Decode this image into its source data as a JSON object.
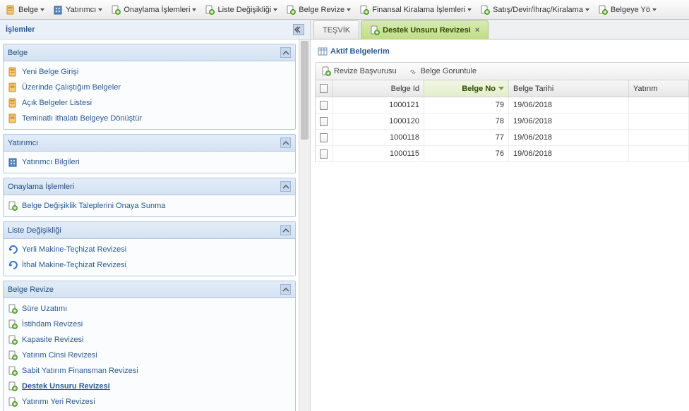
{
  "toolbar": [
    {
      "label": "Belge",
      "icon": "document"
    },
    {
      "label": "Yatırımcı",
      "icon": "building"
    },
    {
      "label": "Onaylama İşlemleri",
      "icon": "doc-green"
    },
    {
      "label": "Liste Değişikliği",
      "icon": "doc-green"
    },
    {
      "label": "Belge Revize",
      "icon": "doc-green"
    },
    {
      "label": "Finansal Kiralama İşlemleri",
      "icon": "doc-green"
    },
    {
      "label": "Satış/Devir/İhraç/Kiralama",
      "icon": "doc-green"
    },
    {
      "label": "Belgeye Yö",
      "icon": "doc-green"
    }
  ],
  "sidebar_title": "İşlemler",
  "panels": [
    {
      "title": "Belge",
      "items": [
        {
          "label": "Yeni Belge Girişi",
          "icon": "document"
        },
        {
          "label": "Üzerinde Çalıştığım Belgeler",
          "icon": "document"
        },
        {
          "label": "Açık Belgeler Listesi",
          "icon": "document"
        },
        {
          "label": "Teminatlı ithalatı Belgeye Dönüştür",
          "icon": "document"
        }
      ]
    },
    {
      "title": "Yatırımcı",
      "items": [
        {
          "label": "Yatırımcı Bilgileri",
          "icon": "building"
        }
      ]
    },
    {
      "title": "Onaylama İşlemleri",
      "items": [
        {
          "label": "Belge Değişiklik Taleplerini Onaya Sunma",
          "icon": "doc-green"
        }
      ]
    },
    {
      "title": "Liste Değişikliği",
      "items": [
        {
          "label": "Yerli Makine-Teçhizat Revizesi",
          "icon": "arrow"
        },
        {
          "label": "İthal Makine-Teçhizat Revizesi",
          "icon": "arrow"
        }
      ]
    },
    {
      "title": "Belge Revize",
      "items": [
        {
          "label": "Süre Uzatımı",
          "icon": "doc-green"
        },
        {
          "label": "İstihdam Revizesi",
          "icon": "doc-green"
        },
        {
          "label": "Kapasite Revizesi",
          "icon": "doc-green"
        },
        {
          "label": "Yatırım Cinsi Revizesi",
          "icon": "doc-green"
        },
        {
          "label": "Sabit Yatırım Finansman Revizesi",
          "icon": "doc-green"
        },
        {
          "label": "Destek Unsuru Revizesi",
          "icon": "doc-green",
          "bold": true
        },
        {
          "label": "Yatırımı Yeri Revizesi",
          "icon": "doc-green"
        }
      ]
    }
  ],
  "tabs": [
    {
      "label": "TEŞVİK",
      "active": false,
      "closable": false
    },
    {
      "label": "Destek Unsuru Revizesi",
      "active": true,
      "closable": true
    }
  ],
  "content_title": "Aktif Belgelerim",
  "content_toolbar": [
    {
      "label": "Revize Başvurusu",
      "icon": "doc-green"
    },
    {
      "label": "Belge Goruntule",
      "icon": "chain"
    }
  ],
  "grid": {
    "columns": [
      "",
      "Belge Id",
      "Belge No",
      "Belge Tarihi",
      "Yatırım"
    ],
    "sort_col": "Belge No",
    "rows": [
      {
        "belgeId": "1000121",
        "belgeNo": "79",
        "tarih": "19/06/2018"
      },
      {
        "belgeId": "1000120",
        "belgeNo": "78",
        "tarih": "19/06/2018"
      },
      {
        "belgeId": "1000118",
        "belgeNo": "77",
        "tarih": "19/06/2018"
      },
      {
        "belgeId": "1000115",
        "belgeNo": "76",
        "tarih": "19/06/2018"
      }
    ]
  }
}
